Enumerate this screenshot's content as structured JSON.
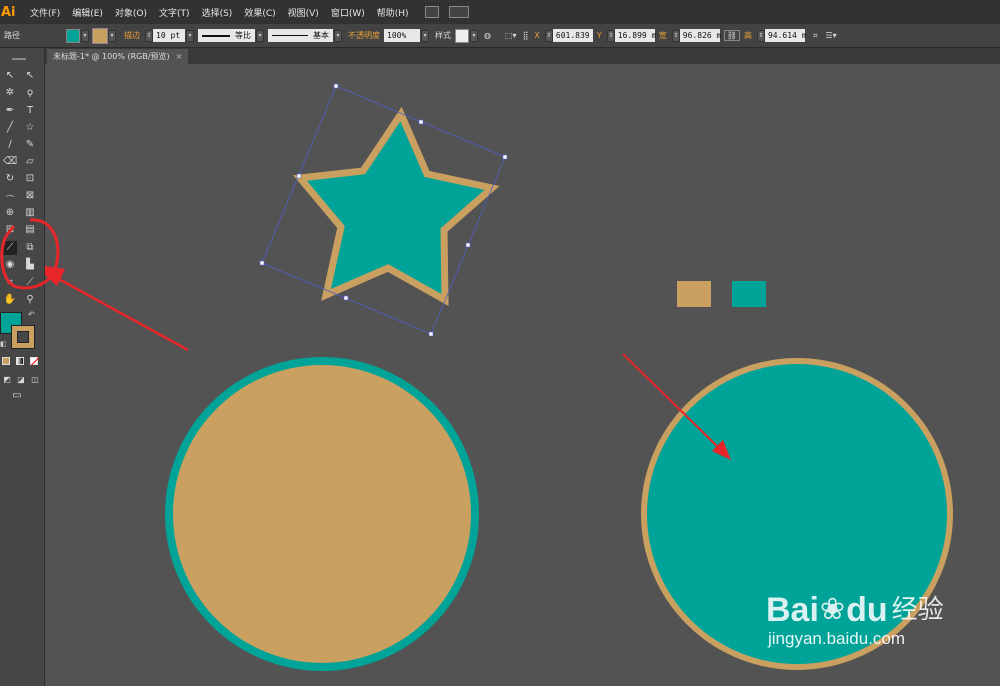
{
  "app": {
    "logo": "Ai"
  },
  "menu": [
    "文件(F)",
    "编辑(E)",
    "对象(O)",
    "文字(T)",
    "选择(S)",
    "效果(C)",
    "视图(V)",
    "窗口(W)",
    "帮助(H)"
  ],
  "control_bar": {
    "selection_type": "路径",
    "stroke_label": "描边",
    "stroke_weight": "10 pt",
    "stroke_profile": "等比",
    "brush": "基本",
    "opacity_label": "不透明度",
    "opacity_value": "100%",
    "style_label": "样式",
    "x_label": "X",
    "x_value": "601.839",
    "y_label": "Y",
    "y_value": "16.899 m",
    "w_label": "宽",
    "w_value": "96.826 m",
    "h_label": "高",
    "h_value": "94.614 m"
  },
  "document_tab": {
    "title": "未标题-1* @ 100% (RGB/预览)",
    "close": "×"
  },
  "colors": {
    "teal": "#00a397",
    "tan": "#c9a060",
    "annotation_red": "#e8262a"
  },
  "watermark": {
    "brand": "Bai",
    "brand2": "du",
    "suffix": "经验",
    "url": "jingyan.baidu.com"
  }
}
